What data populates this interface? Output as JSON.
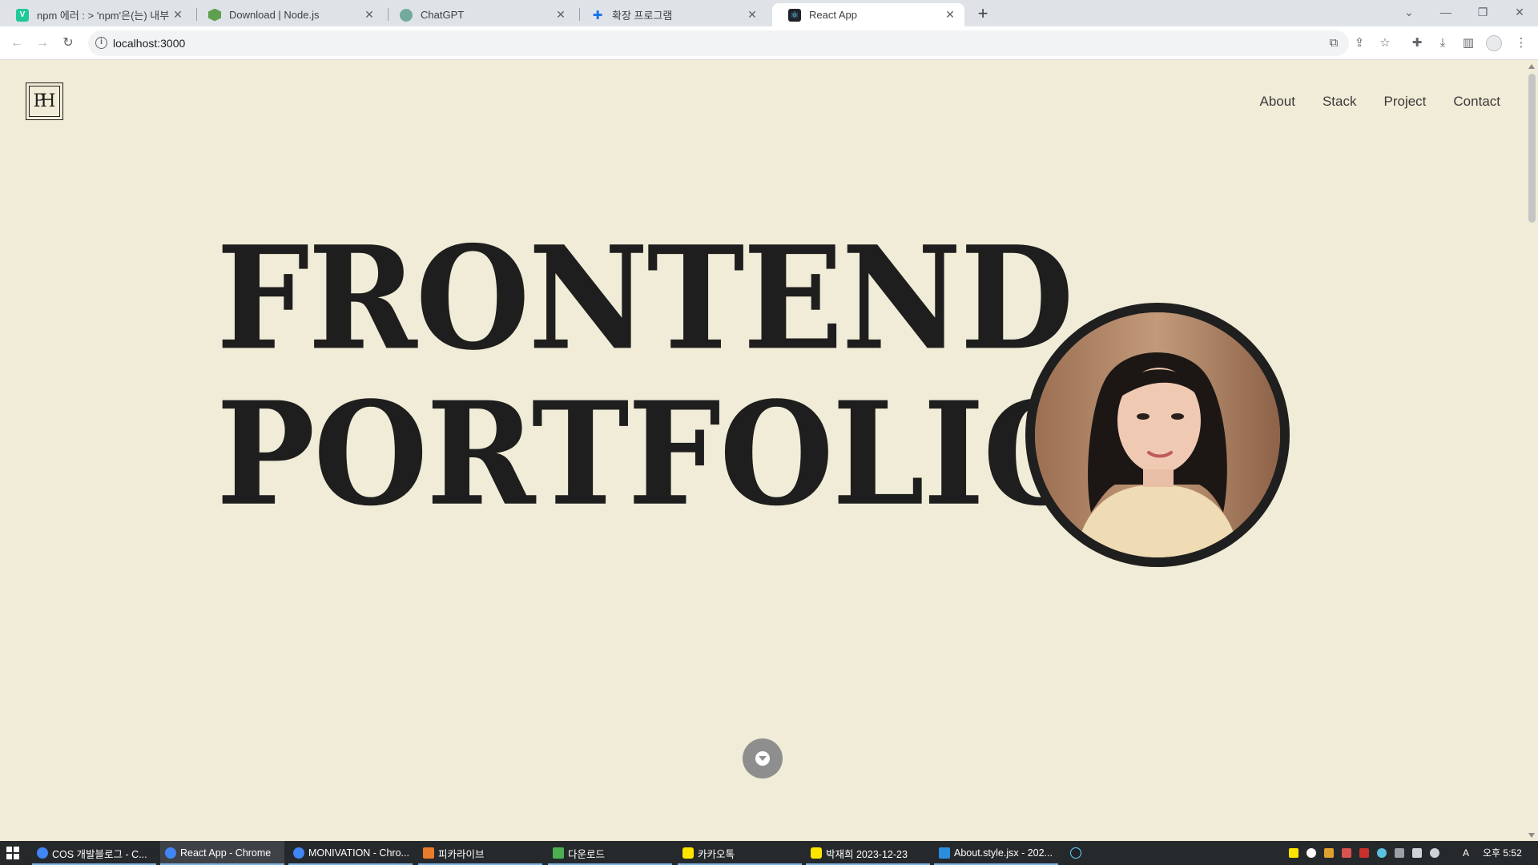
{
  "browser": {
    "tabs": [
      {
        "title": "npm 에러 : > 'npm'은(는) 내부",
        "favicon": "V",
        "color": "#20c997"
      },
      {
        "title": "Download | Node.js",
        "favicon": "",
        "color": "#5fa04e"
      },
      {
        "title": "ChatGPT",
        "favicon": "",
        "color": "#74aa9c"
      },
      {
        "title": "확장 프로그램",
        "favicon": "",
        "color": "#1a73e8"
      },
      {
        "title": "React App",
        "favicon": "",
        "color": "#20232a"
      }
    ],
    "url": "localhost:3000"
  },
  "site": {
    "logo_text": "PH",
    "nav": [
      "About",
      "Stack",
      "Project",
      "Contact"
    ],
    "hero_line1": "FRONTEND",
    "hero_line2": "PORTFOLIO"
  },
  "taskbar": {
    "items": [
      {
        "label": "COS 개발블로그 - C...",
        "icon_color": "#4285f4"
      },
      {
        "label": "React App - Chrome",
        "icon_color": "#4285f4"
      },
      {
        "label": "MONIVATION - Chro...",
        "icon_color": "#4285f4"
      },
      {
        "label": "피카라이브",
        "icon_color": "#e87b2c"
      },
      {
        "label": "다운로드",
        "icon_color": "#4caf50"
      },
      {
        "label": "카카오톡",
        "icon_color": "#fee500"
      },
      {
        "label": "박재희 2023-12-23",
        "icon_color": "#fee500"
      },
      {
        "label": "About.style.jsx - 202...",
        "icon_color": "#2b8de0"
      }
    ],
    "clock": "오후 5:52",
    "ime": "A"
  }
}
